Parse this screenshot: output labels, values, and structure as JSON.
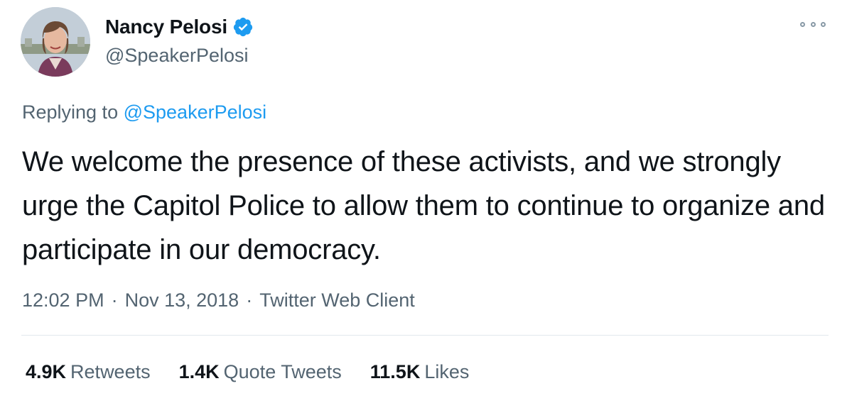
{
  "user": {
    "display_name": "Nancy Pelosi",
    "handle": "@SpeakerPelosi",
    "verified": true,
    "verified_color": "#1d9bf0"
  },
  "reply": {
    "prefix": "Replying to",
    "mention": "@SpeakerPelosi"
  },
  "tweet": {
    "text": "We welcome the presence of these activists, and we strongly urge the Capitol Police to allow them to continue to organize and participate in our democracy."
  },
  "meta": {
    "time": "12:02 PM",
    "date": "Nov 13, 2018",
    "source": "Twitter Web Client",
    "separator": "·"
  },
  "stats": {
    "retweets": {
      "count": "4.9K",
      "label": "Retweets"
    },
    "quote_tweets": {
      "count": "1.4K",
      "label": "Quote Tweets"
    },
    "likes": {
      "count": "11.5K",
      "label": "Likes"
    }
  },
  "icons": {
    "more": "more-options-icon",
    "verified": "verified-badge-icon"
  },
  "colors": {
    "text": "#0f1419",
    "secondary": "#536471",
    "link": "#1d9bf0",
    "divider": "#e1e8ed"
  }
}
